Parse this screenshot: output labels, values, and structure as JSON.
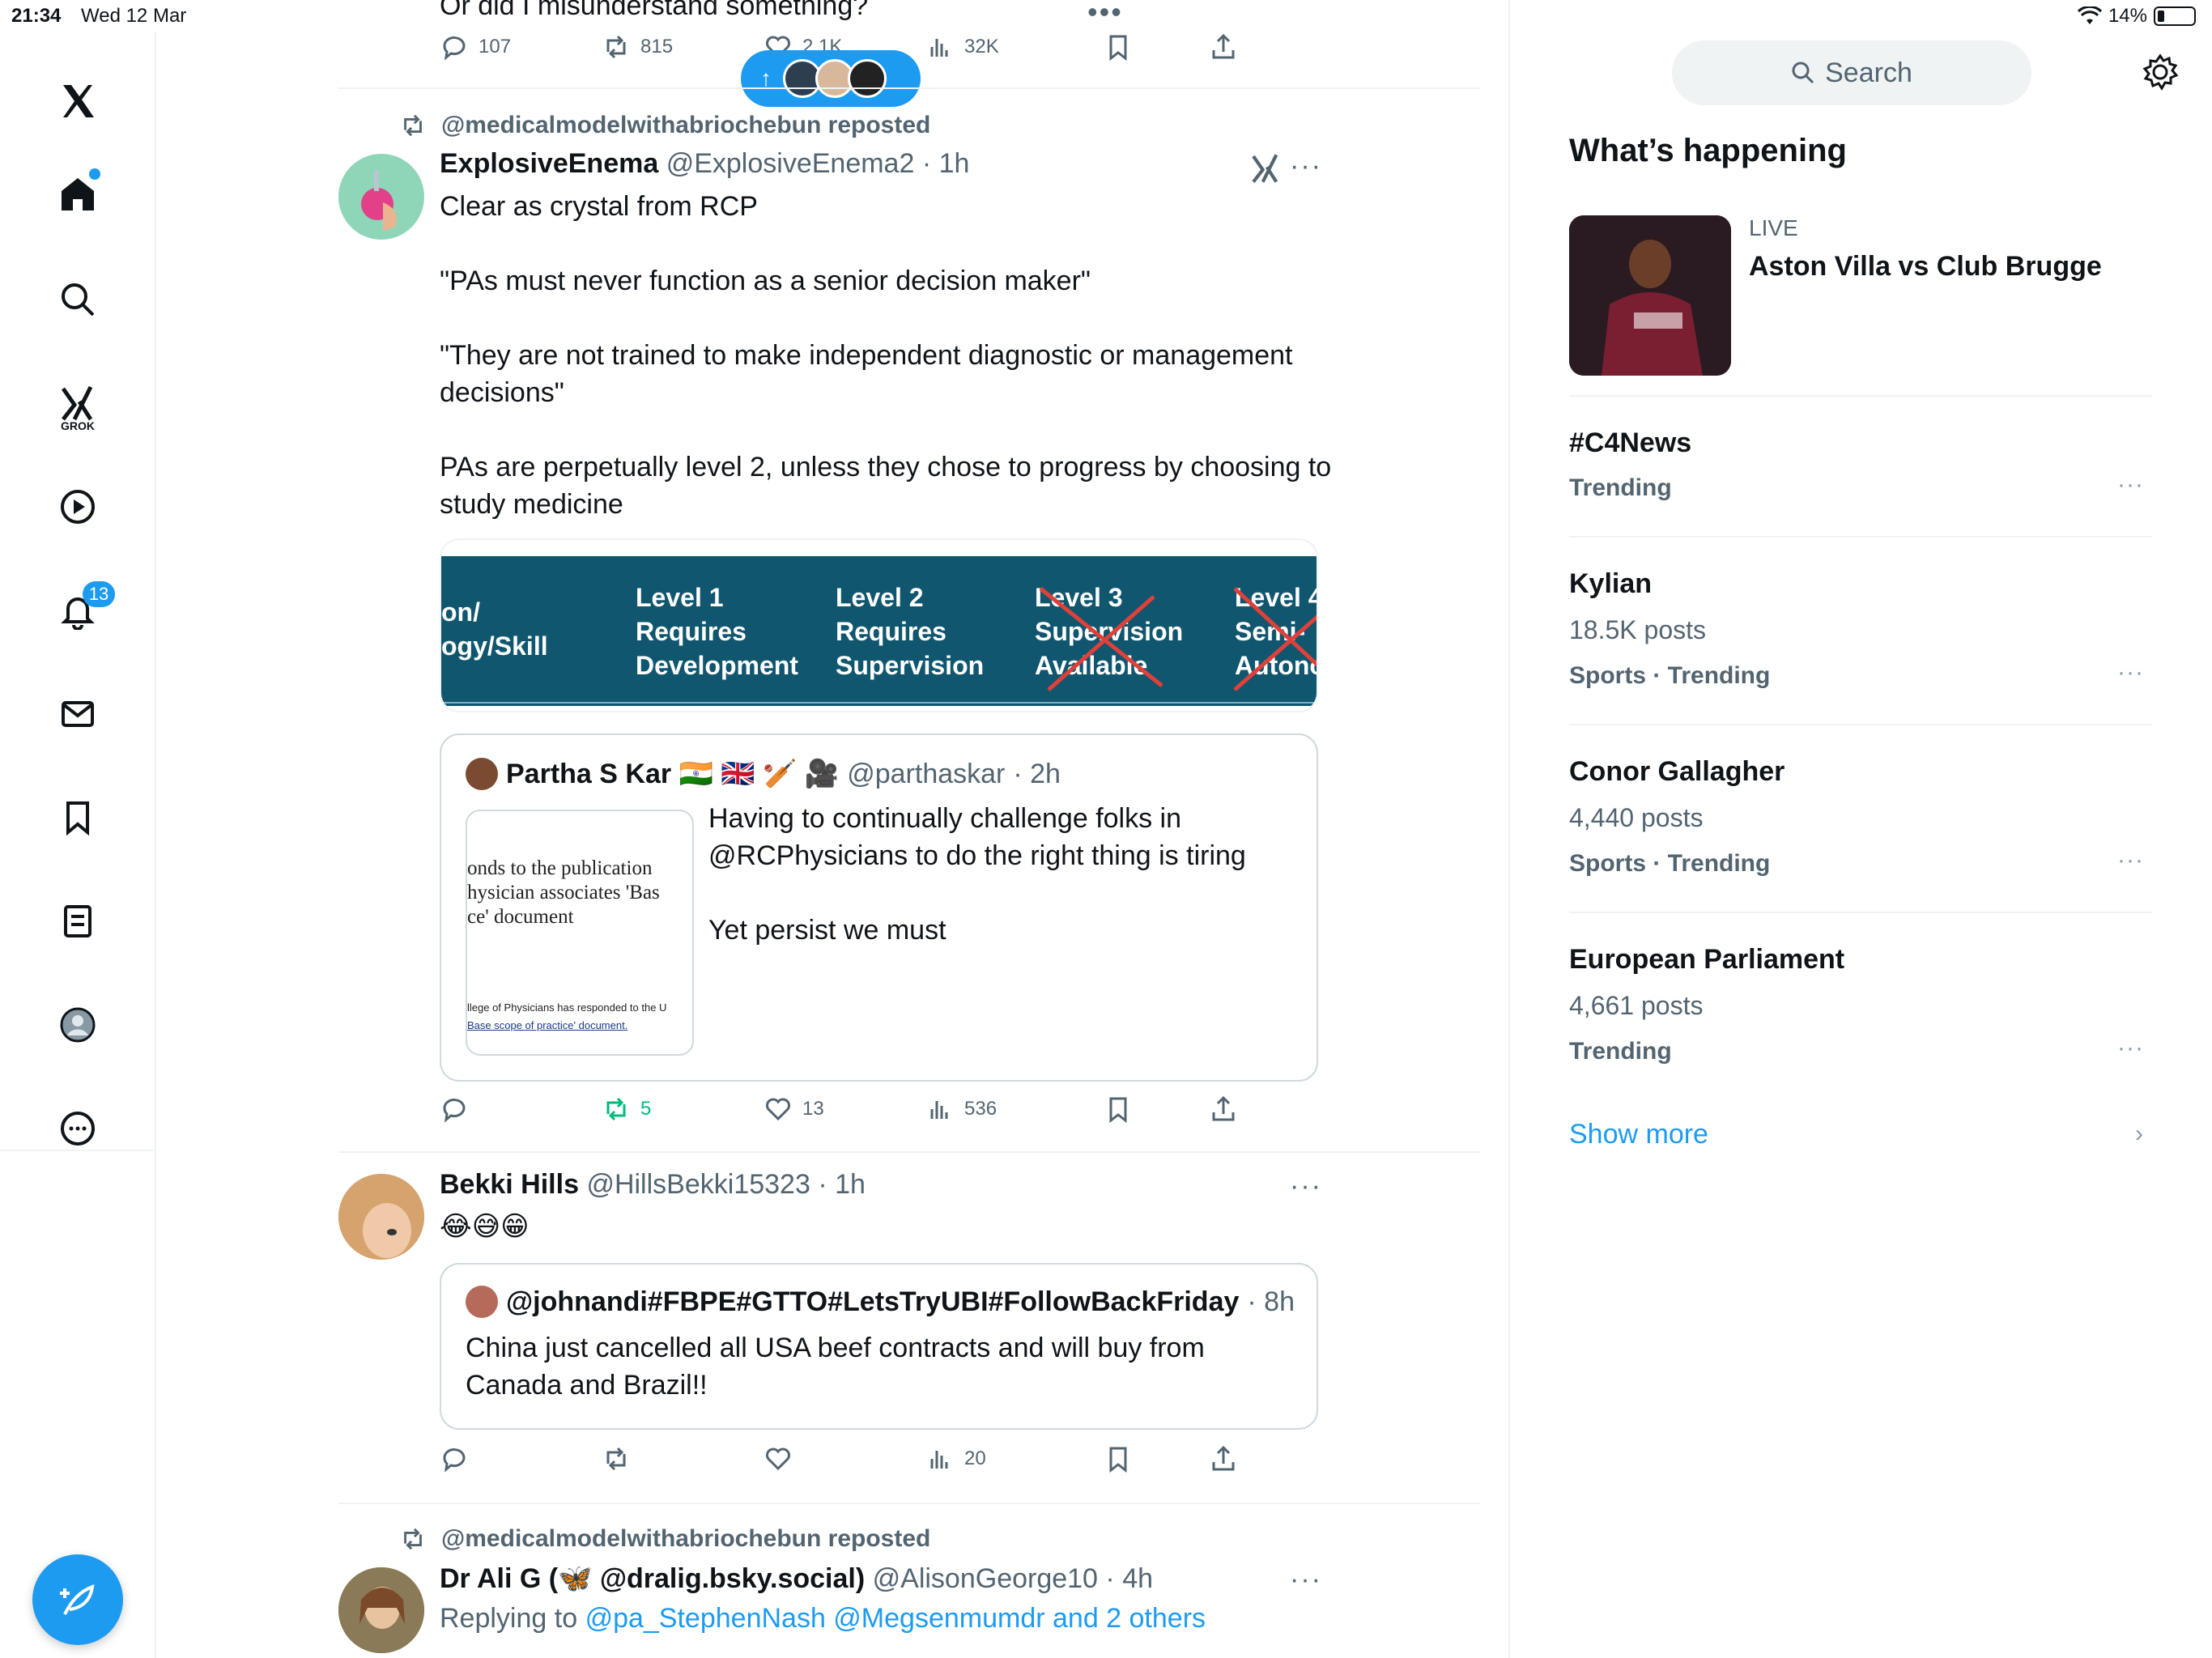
{
  "status": {
    "time": "21:34",
    "date": "Wed 12 Mar",
    "battery": "14%"
  },
  "nav": {
    "grok_label": "GROK",
    "notifications_badge": "13"
  },
  "top_partial": {
    "text": "Or did I misunderstand something?",
    "replies": "107",
    "reposts": "815",
    "likes": "2.1K",
    "views": "32K"
  },
  "tweet1": {
    "repost_by": "@medicalmodelwithabriochebun reposted",
    "name": "ExplosiveEnema",
    "handle": "@ExplosiveEnema2",
    "time": "· 1h",
    "paragraphs": [
      "Clear as crystal from RCP",
      "\"PAs must never function as a senior decision maker\"",
      "\"They are not trained to make independent diagnostic or management decisions\"",
      "PAs are perpetually level 2, unless they chose to progress by choosing to study medicine"
    ],
    "media": {
      "col0": [
        "on/",
        "ogy/Skill"
      ],
      "col1": [
        "Level 1",
        "Requires",
        "Development"
      ],
      "col2": [
        "Level 2",
        "Requires",
        "Supervision"
      ],
      "col3": [
        "Level 3",
        "Supervision",
        "Available"
      ],
      "col4": [
        "Level 4",
        "Semi-",
        "Autono"
      ]
    },
    "quote": {
      "name": "Partha S Kar 🇮🇳 🇬🇧 🏏 🎥",
      "handle": "@parthaskar",
      "time": "· 2h",
      "paragraphs": [
        "Having to continually challenge folks in @RCPhysicians to do the right thing is tiring",
        "Yet persist we must"
      ],
      "thumb_lines": [
        "onds to the publication",
        "hysician associates 'Bas",
        "ce' document"
      ],
      "thumb_small": [
        "llege of Physicians has responded to the U",
        "Base scope of practice' document."
      ]
    },
    "replies": "",
    "reposts": "5",
    "likes": "13",
    "views": "536"
  },
  "tweet2": {
    "name": "Bekki Hills",
    "handle": "@HillsBekki15323",
    "time": "· 1h",
    "text": "😂😅😁",
    "quote": {
      "name": "@johnandi#FBPE#GTTO#LetsTryUBI#FollowBackFriday",
      "time": "· 8h",
      "text": "China just cancelled all USA beef contracts and will buy from Canada and Brazil!!"
    },
    "views": "20"
  },
  "tweet3": {
    "repost_by": "@medicalmodelwithabriochebun reposted",
    "name": "Dr Ali G (🦋 @dralig.bsky.social)",
    "handle": "@AlisonGeorge10",
    "time": "· 4h",
    "replying_label": "Replying to",
    "replying_links": "@pa_StephenNash @Megsenmumdr and 2 others"
  },
  "sidebar": {
    "search_placeholder": "Search",
    "title": "What’s happening",
    "live_label": "LIVE",
    "live_title": "Aston Villa vs Club Brugge",
    "trends": [
      {
        "title": "#C4News",
        "posts": "",
        "category": "Trending"
      },
      {
        "title": "Kylian",
        "posts": "18.5K posts",
        "category": "Sports · Trending"
      },
      {
        "title": "Conor Gallagher",
        "posts": "4,440 posts",
        "category": "Sports · Trending"
      },
      {
        "title": "European Parliament",
        "posts": "4,661 posts",
        "category": "Trending"
      }
    ],
    "show_more": "Show more"
  },
  "colors": {
    "accent": "#1d9bf0",
    "repost_green": "#00ba7c",
    "muted": "#536471"
  }
}
